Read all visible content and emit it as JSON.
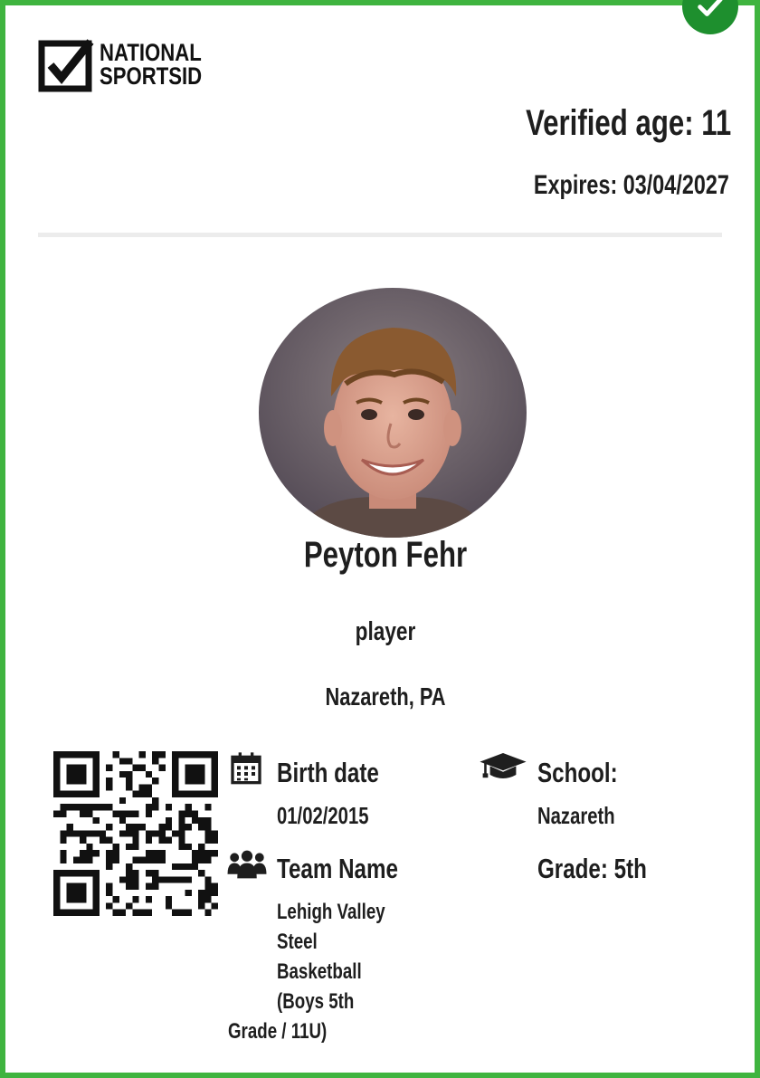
{
  "brand": {
    "line1": "NATIONAL",
    "line2": "SPORTSID"
  },
  "card": {
    "verified_age": "Verified age: 11",
    "expires": "Expires: 03/04/2027"
  },
  "profile": {
    "name": "Peyton Fehr",
    "role": "player",
    "location": "Nazareth, PA"
  },
  "details": {
    "birth_label": "Birth date",
    "birth_value": "01/02/2015",
    "team_label": "Team Name",
    "team_lines": [
      "Lehigh Valley",
      "Steel",
      "Basketball",
      "(Boys 5th",
      "Grade / 11U)"
    ],
    "school_label": "School:",
    "school_value": "Nazareth",
    "grade": "Grade: 5th"
  },
  "icons": {
    "status": "check-circle-icon",
    "logo": "checkbox-logo-icon",
    "birth": "calendar-icon",
    "team": "group-icon",
    "school": "graduation-cap-icon"
  },
  "colors": {
    "border": "#3fb43f",
    "check": "#1e8f2e",
    "text": "#1e1e1e",
    "divider": "#ececec"
  }
}
